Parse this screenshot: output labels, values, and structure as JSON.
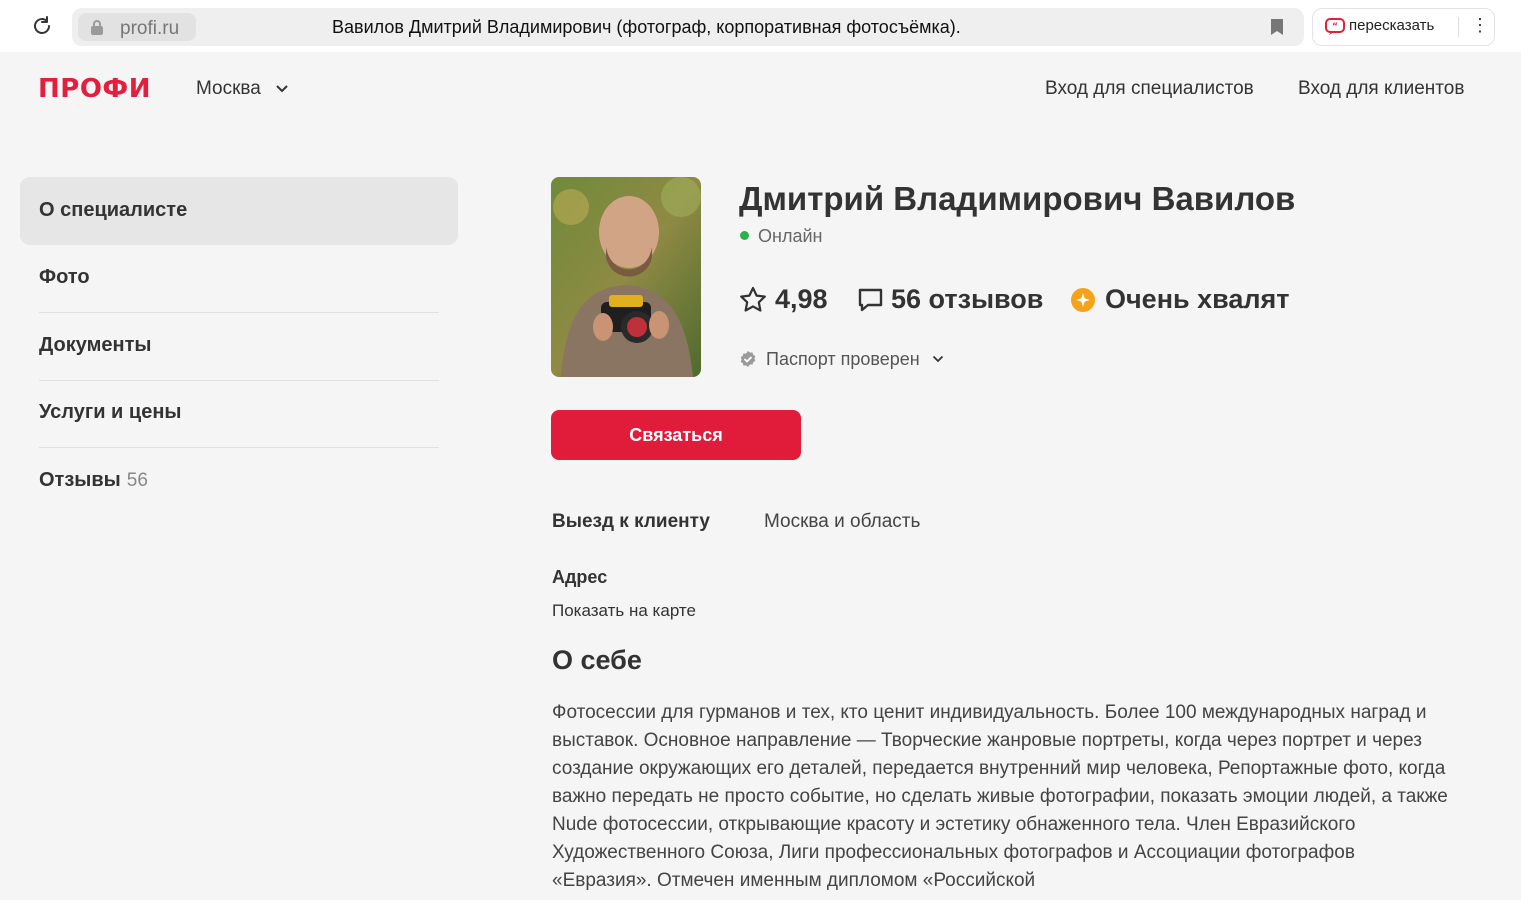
{
  "browser": {
    "domain": "profi.ru",
    "page_title": "Вавилов Дмитрий Владимирович (фотограф, корпоративная фотосъёмка).",
    "retell_label": "пересказать"
  },
  "header": {
    "logo": "ПРОФИ",
    "city": "Москва",
    "login_specialists": "Вход для специалистов",
    "login_clients": "Вход для клиентов"
  },
  "sidebar": {
    "items": [
      {
        "label": "О специалисте"
      },
      {
        "label": "Фото"
      },
      {
        "label": "Документы"
      },
      {
        "label": "Услуги и цены"
      },
      {
        "label": "Отзывы",
        "count": "56"
      }
    ]
  },
  "profile": {
    "name": "Дмитрий Владимирович Вавилов",
    "status": "Онлайн",
    "rating": "4,98",
    "reviews": "56 отзывов",
    "praise": "Очень хвалят",
    "passport": "Паспорт проверен",
    "contact_button": "Связаться",
    "visit_label": "Выезд к клиенту",
    "visit_value": "Москва и область",
    "address_label": "Адрес",
    "map_link": "Показать на карте"
  },
  "about": {
    "title": "О себе",
    "text": "Фотосессии для гурманов и тех, кто ценит индивидуальность. Более 100 международных наград и выставок. Основное направление — Творческие жанровые портреты, когда через портрет и через создание окружающих его деталей, передается внутренний мир человека, Репортажные фото, когда важно передать не просто событие, но сделать живые фотографии, показать эмоции людей, а также Nude фотосессии, открывающие красоту и эстетику обнаженного тела. Член Евразийского Художественного Союза, Лиги профессиональных фотографов и Ассоциации фотографов «Евразия». Отмечен именным дипломом «Российской"
  },
  "colors": {
    "brand": "#e2203e",
    "button": "#e01c3a",
    "online": "#2bb24c",
    "praise": "#f7a21b"
  },
  "icons": [
    "reload-icon",
    "lock-icon",
    "bookmark-icon",
    "retell-icon",
    "kebab-icon",
    "chevron-down-icon",
    "star-icon",
    "comment-icon",
    "praise-icon",
    "verified-icon"
  ]
}
